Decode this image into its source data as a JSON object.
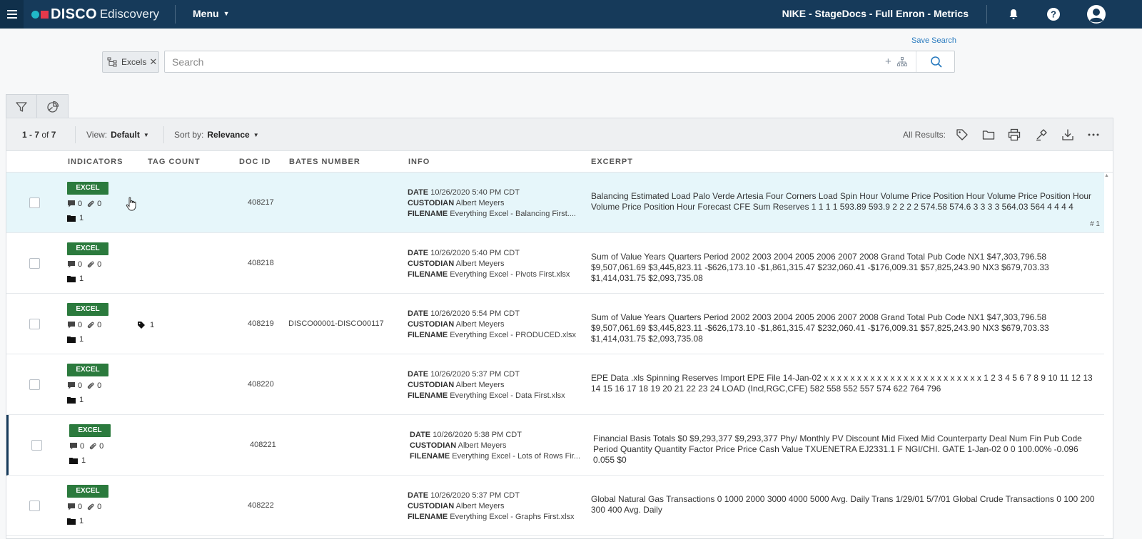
{
  "topbar": {
    "brand": "DISCO",
    "product": "Ediscovery",
    "menu_label": "Menu",
    "project": "NIKE - StageDocs - Full Enron - Metrics"
  },
  "search": {
    "save_search": "Save Search",
    "chip_label": "Excels",
    "placeholder": "Search",
    "value": ""
  },
  "toolbar": {
    "range": "1 - 7",
    "of_label": "of",
    "total": "7",
    "view_label": "View:",
    "view_value": "Default",
    "sort_label": "Sort by:",
    "sort_value": "Relevance",
    "all_results": "All Results:"
  },
  "columns": {
    "indicators": "INDICATORS",
    "tag_count": "TAG COUNT",
    "doc_id": "DOC ID",
    "bates": "BATES NUMBER",
    "info": "INFO",
    "excerpt": "EXCERPT"
  },
  "info_labels": {
    "date": "DATE",
    "custodian": "CUSTODIAN",
    "filename": "FILENAME"
  },
  "rows": [
    {
      "badge": "EXCEL",
      "notes": "0",
      "attachments": "0",
      "folders": "1",
      "tags": "",
      "doc_id": "408217",
      "bates": "",
      "date": "10/26/2020 5:40 PM CDT",
      "custodian": "Albert Meyers",
      "filename": "Everything Excel - Balancing First....",
      "excerpt": "Balancing Estimated Load Palo Verde Artesia Four Corners Load Spin Hour Volume Price Position Hour Volume Price Position Hour Volume Price Position Hour Forecast CFE Sum Reserves 1 1 1 1 593.89 593.9 2 2 2 2 574.58 574.6 3 3 3 3 564.03 564 4 4 4 4",
      "rownum": "# 1"
    },
    {
      "badge": "EXCEL",
      "notes": "0",
      "attachments": "0",
      "folders": "1",
      "tags": "",
      "doc_id": "408218",
      "bates": "",
      "date": "10/26/2020 5:40 PM CDT",
      "custodian": "Albert Meyers",
      "filename": "Everything Excel - Pivots First.xlsx",
      "excerpt": "Sum of Value Years Quarters Period 2002 2003 2004 2005 2006 2007 2008 Grand Total Pub Code NX1 $47,303,796.58 $9,507,061.69 $3,445,823.11 -$626,173.10 -$1,861,315.47 $232,060.41 -$176,009.31 $57,825,243.90 NX3 $679,703.33 $1,414,031.75 $2,093,735.08",
      "rownum": ""
    },
    {
      "badge": "EXCEL",
      "notes": "0",
      "attachments": "0",
      "folders": "1",
      "tags": "1",
      "doc_id": "408219",
      "bates": "DISCO00001-DISCO00117",
      "date": "10/26/2020 5:54 PM CDT",
      "custodian": "Albert Meyers",
      "filename": "Everything Excel - PRODUCED.xlsx",
      "excerpt": "Sum of Value Years Quarters Period 2002 2003 2004 2005 2006 2007 2008 Grand Total Pub Code NX1 $47,303,796.58 $9,507,061.69 $3,445,823.11 -$626,173.10 -$1,861,315.47 $232,060.41 -$176,009.31 $57,825,243.90 NX3 $679,703.33 $1,414,031.75 $2,093,735.08",
      "rownum": ""
    },
    {
      "badge": "EXCEL",
      "notes": "0",
      "attachments": "0",
      "folders": "1",
      "tags": "",
      "doc_id": "408220",
      "bates": "",
      "date": "10/26/2020 5:37 PM CDT",
      "custodian": "Albert Meyers",
      "filename": "Everything Excel - Data First.xlsx",
      "excerpt": "EPE Data .xls Spinning Reserves Import EPE File 14-Jan-02 x x x x x x x x x x x x x x x x x x x x x x x x 1 2 3 4 5 6 7 8 9 10 11 12 13 14 15 16 17 18 19 20 21 22 23 24 LOAD (Incl,RGC,CFE) 582 558 552 557 574 622 764 796",
      "rownum": ""
    },
    {
      "badge": "EXCEL",
      "notes": "0",
      "attachments": "0",
      "folders": "1",
      "tags": "",
      "doc_id": "408221",
      "bates": "",
      "date": "10/26/2020 5:38 PM CDT",
      "custodian": "Albert Meyers",
      "filename": "Everything Excel - Lots of Rows Fir...",
      "excerpt": "Financial Basis Totals $0 $9,293,377 $9,293,377 Phy/ Monthly PV Discount Mid Fixed Mid Counterparty Deal Num Fin Pub Code Period Quantity Quantity Factor Price Price Cash Value TXUENETRA EJ2331.1 F NGI/CHI. GATE 1-Jan-02 0 0 100.00% -0.096 0.055 $0",
      "rownum": ""
    },
    {
      "badge": "EXCEL",
      "notes": "0",
      "attachments": "0",
      "folders": "1",
      "tags": "",
      "doc_id": "408222",
      "bates": "",
      "date": "10/26/2020 5:37 PM CDT",
      "custodian": "Albert Meyers",
      "filename": "Everything Excel - Graphs First.xlsx",
      "excerpt": "Global Natural Gas Transactions 0 1000 2000 3000 4000 5000 Avg. Daily Trans 1/29/01 5/7/01 Global Crude Transactions 0 100 200 300 400 Avg. Daily",
      "rownum": ""
    }
  ],
  "colors": {
    "topbar": "#163a5a",
    "excel_badge": "#2b7a3d",
    "highlight_row": "#e6f6fa",
    "link": "#2a7bbf"
  },
  "icons": [
    "menu-icon",
    "bell-icon",
    "help-icon",
    "user-icon",
    "filter-icon",
    "pie-chart-icon",
    "tag-icon",
    "folder-icon",
    "print-icon",
    "redact-icon",
    "download-icon",
    "more-icon",
    "search-icon",
    "hierarchy-icon",
    "note-icon",
    "paperclip-icon"
  ]
}
